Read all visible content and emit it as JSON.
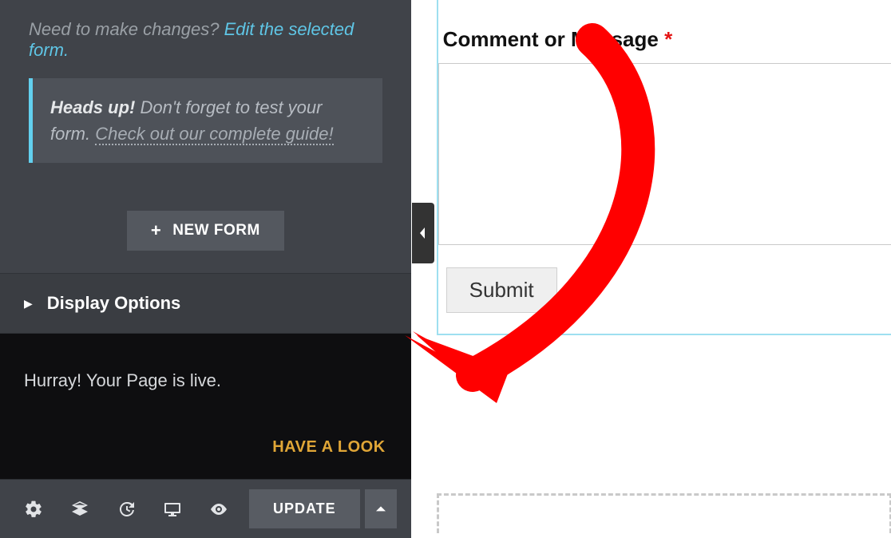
{
  "sidebar": {
    "edit_prompt": "Need to make changes? ",
    "edit_link": "Edit the selected form.",
    "tip": {
      "heads": "Heads up!",
      "body": " Don't forget to test your form. ",
      "guide_link": "Check out our complete guide!"
    },
    "new_form_label": "NEW FORM",
    "display_options_label": "Display Options",
    "live_message": "Hurray! Your Page is live.",
    "have_a_look": "HAVE A LOOK",
    "update_label": "UPDATE"
  },
  "form": {
    "comment_label": "Comment or Message ",
    "required_marker": "*",
    "comment_value": "",
    "submit_label": "Submit"
  }
}
